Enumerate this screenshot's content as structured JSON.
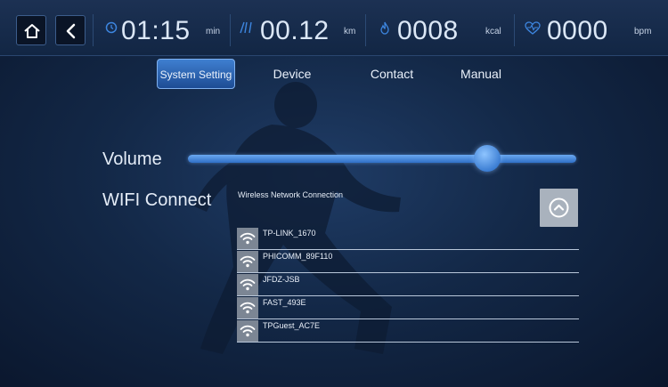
{
  "topbar": {
    "metrics": [
      {
        "icon": "clock-icon",
        "value": "01:15",
        "unit": "min"
      },
      {
        "icon": "distance-icon",
        "value": "00.12",
        "unit": "km"
      },
      {
        "icon": "flame-icon",
        "value": "0008",
        "unit": "kcal"
      },
      {
        "icon": "heart-rate-icon",
        "value": "0000",
        "unit": "bpm"
      }
    ]
  },
  "tabs": [
    {
      "label": "System Setting",
      "active": true
    },
    {
      "label": "Device",
      "active": false
    },
    {
      "label": "Contact",
      "active": false
    },
    {
      "label": "Manual",
      "active": false
    }
  ],
  "settings": {
    "volume_label": "Volume",
    "volume_level": 0.77,
    "wifi_label": "WIFI Connect",
    "wifi_caption": "Wireless Network Connection"
  },
  "networks": [
    {
      "ssid": "TP-LINK_1670"
    },
    {
      "ssid": "PHICOMM_89F110"
    },
    {
      "ssid": "JFDZ-JSB"
    },
    {
      "ssid": "FAST_493E"
    },
    {
      "ssid": "TPGuest_AC7E"
    }
  ],
  "colors": {
    "accent": "#3f7fd0",
    "background": "#132847",
    "track": "#4a8ae0"
  }
}
